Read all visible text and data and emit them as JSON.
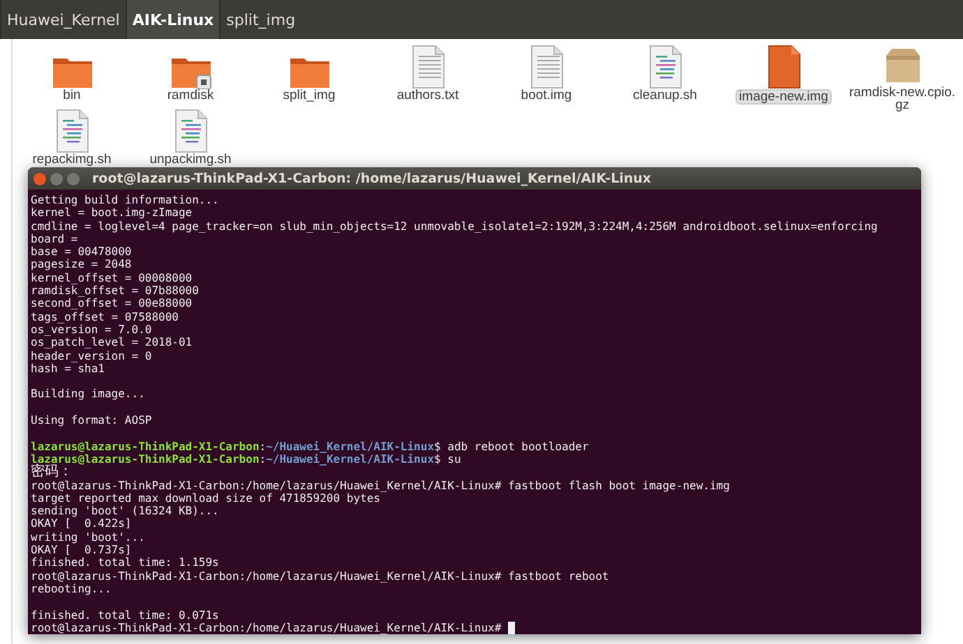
{
  "path_bar": {
    "tabs": [
      {
        "label": "Huawei_Kernel",
        "selected": false
      },
      {
        "label": "AIK-Linux",
        "selected": true
      },
      {
        "label": "split_img",
        "selected": false
      }
    ]
  },
  "files": [
    {
      "name": "bin",
      "kind": "folder",
      "selected": false
    },
    {
      "name": "ramdisk",
      "kind": "locked_folder",
      "selected": false
    },
    {
      "name": "split_img",
      "kind": "folder",
      "selected": false
    },
    {
      "name": "authors.txt",
      "kind": "text",
      "selected": false
    },
    {
      "name": "boot.img",
      "kind": "text",
      "selected": false
    },
    {
      "name": "cleanup.sh",
      "kind": "script",
      "selected": false
    },
    {
      "name": "image-new.img",
      "kind": "image",
      "selected": true
    },
    {
      "name": "ramdisk-new.cpio.gz",
      "kind": "archive",
      "selected": false
    },
    {
      "name": "repackimg.sh",
      "kind": "script",
      "selected": false
    },
    {
      "name": "unpackimg.sh",
      "kind": "script",
      "selected": false
    }
  ],
  "terminal": {
    "title": "root@lazarus-ThinkPad-X1-Carbon: /home/lazarus/Huawei_Kernel/AIK-Linux",
    "lines": [
      {
        "kind": "output",
        "text": "Getting build information..."
      },
      {
        "kind": "output",
        "text": "kernel = boot.img-zImage"
      },
      {
        "kind": "output",
        "text": "cmdline = loglevel=4 page_tracker=on slub_min_objects=12 unmovable_isolate1=2:192M,3:224M,4:256M androidboot.selinux=enforcing"
      },
      {
        "kind": "output",
        "text": "board ="
      },
      {
        "kind": "output",
        "text": "base = 00478000"
      },
      {
        "kind": "output",
        "text": "pagesize = 2048"
      },
      {
        "kind": "output",
        "text": "kernel_offset = 00008000"
      },
      {
        "kind": "output",
        "text": "ramdisk_offset = 07b88000"
      },
      {
        "kind": "output",
        "text": "second_offset = 00e88000"
      },
      {
        "kind": "output",
        "text": "tags_offset = 07588000"
      },
      {
        "kind": "output",
        "text": "os_version = 7.0.0"
      },
      {
        "kind": "output",
        "text": "os_patch_level = 2018-01"
      },
      {
        "kind": "output",
        "text": "header_version = 0"
      },
      {
        "kind": "output",
        "text": "hash = sha1"
      },
      {
        "kind": "blank"
      },
      {
        "kind": "output",
        "text": "Building image..."
      },
      {
        "kind": "blank"
      },
      {
        "kind": "output",
        "text": "Using format: AOSP"
      },
      {
        "kind": "blank"
      },
      {
        "kind": "prompt",
        "parts": [
          {
            "kind": "user",
            "text": "lazarus@lazarus-ThinkPad-X1-Carbon"
          },
          {
            "kind": "plain",
            "text": ":"
          },
          {
            "kind": "path",
            "text": "~/Huawei_Kernel/AIK-Linux"
          },
          {
            "kind": "plain",
            "text": "$ adb reboot bootloader"
          }
        ]
      },
      {
        "kind": "prompt",
        "parts": [
          {
            "kind": "user",
            "text": "lazarus@lazarus-ThinkPad-X1-Carbon"
          },
          {
            "kind": "plain",
            "text": ":"
          },
          {
            "kind": "path",
            "text": "~/Huawei_Kernel/AIK-Linux"
          },
          {
            "kind": "plain",
            "text": "$ su"
          }
        ]
      },
      {
        "kind": "output",
        "text": "密码："
      },
      {
        "kind": "output",
        "text": "root@lazarus-ThinkPad-X1-Carbon:/home/lazarus/Huawei_Kernel/AIK-Linux# fastboot flash boot image-new.img"
      },
      {
        "kind": "output",
        "text": "target reported max download size of 471859200 bytes"
      },
      {
        "kind": "output",
        "text": "sending 'boot' (16324 KB)..."
      },
      {
        "kind": "output",
        "text": "OKAY [  0.422s]"
      },
      {
        "kind": "output",
        "text": "writing 'boot'..."
      },
      {
        "kind": "output",
        "text": "OKAY [  0.737s]"
      },
      {
        "kind": "output",
        "text": "finished. total time: 1.159s"
      },
      {
        "kind": "output",
        "text": "root@lazarus-ThinkPad-X1-Carbon:/home/lazarus/Huawei_Kernel/AIK-Linux# fastboot reboot"
      },
      {
        "kind": "output",
        "text": "rebooting..."
      },
      {
        "kind": "blank"
      },
      {
        "kind": "output",
        "text": "finished. total time: 0.071s"
      },
      {
        "kind": "output",
        "text": "root@lazarus-ThinkPad-X1-Carbon:/home/lazarus/Huawei_Kernel/AIK-Linux# ",
        "cursor": true
      }
    ]
  }
}
